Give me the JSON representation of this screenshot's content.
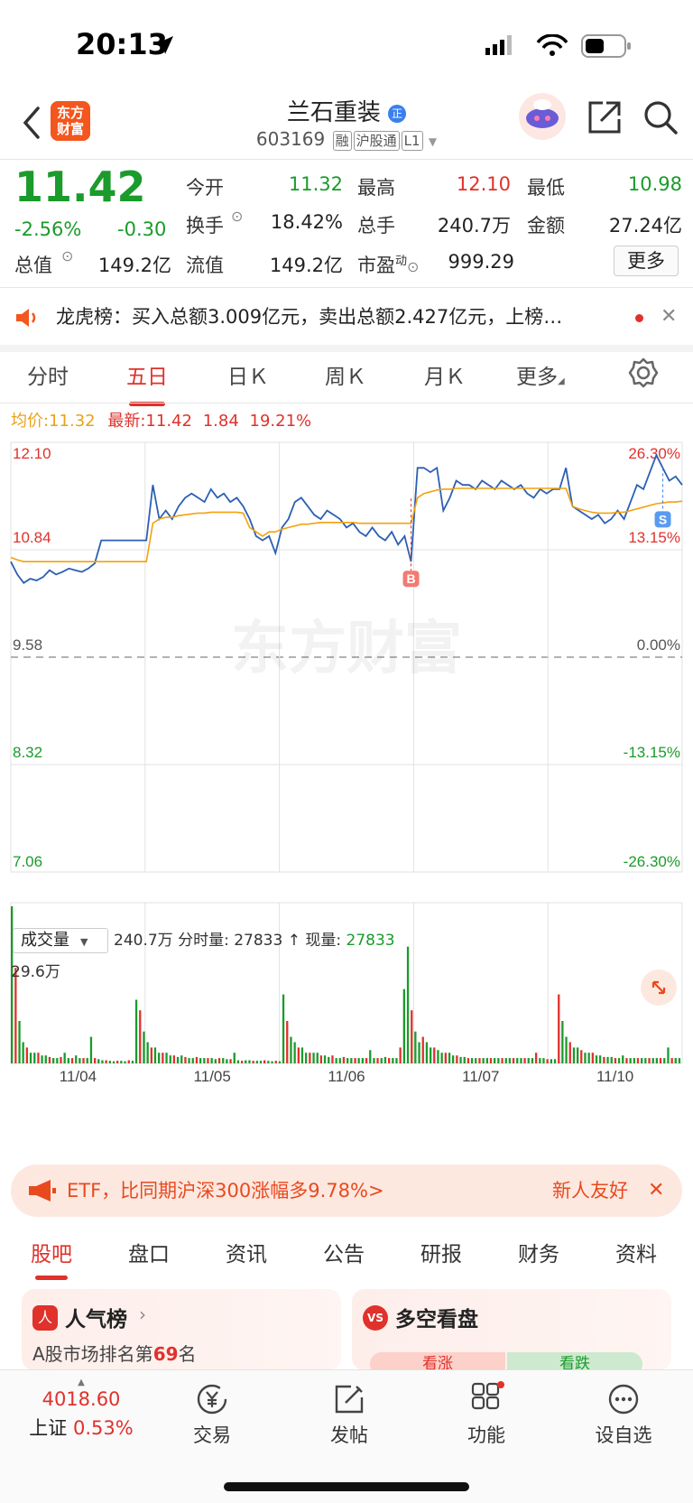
{
  "status": {
    "time": "20:13"
  },
  "header": {
    "logo_text": "东方财富",
    "title": "兰石重装",
    "title_badge": "正",
    "code": "603169",
    "tags": [
      "融",
      "沪股通",
      "L1"
    ]
  },
  "quote": {
    "price": "11.42",
    "change_pct": "-2.56%",
    "change": "-0.30",
    "rows": [
      [
        {
          "label": "今开",
          "value": "11.32",
          "color": "green"
        },
        {
          "label": "最高",
          "value": "12.10",
          "color": "red"
        },
        {
          "label": "最低",
          "value": "10.98",
          "color": "green"
        }
      ],
      [
        {
          "label": "换手",
          "value": "18.42%",
          "color": "dark"
        },
        {
          "label": "总手",
          "value": "240.7万",
          "color": "dark"
        },
        {
          "label": "金额",
          "value": "27.24亿",
          "color": "dark"
        }
      ],
      [
        {
          "label": "总值",
          "value": "149.2亿",
          "color": "dark"
        },
        {
          "label": "流值",
          "value": "149.2亿",
          "color": "dark"
        },
        {
          "label": "市盈",
          "value": "999.29",
          "color": "dark"
        }
      ]
    ],
    "pe_superscript": "动",
    "more_label": "更多"
  },
  "banner": {
    "text": "龙虎榜：买入总额3.009亿元，卖出总额2.427亿元，上榜…"
  },
  "tabs": {
    "items": [
      "分时",
      "五日",
      "日Ｋ",
      "周Ｋ",
      "月Ｋ",
      "更多"
    ],
    "active": 1
  },
  "chart_data": {
    "type": "line",
    "strip": {
      "avg_label": "均价:",
      "avg_value": "11.32",
      "latest_label": "最新:",
      "latest_value": "11.42",
      "change": "1.84",
      "change_pct": "19.21%"
    },
    "y_labels_left": [
      "12.10",
      "10.84",
      "9.58",
      "8.32",
      "7.06"
    ],
    "y_labels_right": [
      "26.30%",
      "13.15%",
      "0.00%",
      "-13.15%",
      "-26.30%"
    ],
    "ylim": [
      7.06,
      12.1
    ],
    "prev_close": 9.58,
    "x_labels": [
      "11/04",
      "11/05",
      "11/06",
      "11/07",
      "11/10"
    ],
    "series": [
      {
        "values": [
          10.7,
          10.55,
          10.45,
          10.5,
          10.48,
          10.52,
          10.6,
          10.55,
          10.58,
          10.62,
          10.6,
          10.58,
          10.62,
          10.68,
          10.95,
          10.95,
          10.95,
          10.95,
          10.95,
          10.95,
          10.95,
          10.95,
          11.6,
          11.2,
          11.3,
          11.2,
          11.35,
          11.45,
          11.5,
          11.45,
          11.4,
          11.55,
          11.45,
          11.5,
          11.4,
          11.45,
          11.35,
          11.2,
          11.0,
          10.95,
          11.0,
          10.8,
          11.1,
          11.2,
          11.4,
          11.45,
          11.35,
          11.25,
          11.2,
          11.3,
          11.25,
          11.2,
          11.1,
          11.15,
          11.05,
          11.0,
          11.1,
          11.0,
          10.95,
          11.05,
          10.9,
          11.0,
          10.7,
          11.8,
          11.8,
          11.75,
          11.8,
          11.3,
          11.45,
          11.65,
          11.6,
          11.6,
          11.55,
          11.65,
          11.6,
          11.55,
          11.65,
          11.6,
          11.55,
          11.6,
          11.5,
          11.45,
          11.55,
          11.5,
          11.55,
          11.55,
          11.8,
          11.35,
          11.3,
          11.25,
          11.2,
          11.25,
          11.15,
          11.2,
          11.3,
          11.2,
          11.4,
          11.6,
          11.55,
          11.75,
          11.95,
          11.8,
          11.65,
          11.7,
          11.6
        ]
      },
      {
        "values": [
          10.75,
          10.72,
          10.7,
          10.7,
          10.7,
          10.7,
          10.7,
          10.7,
          10.7,
          10.7,
          10.7,
          10.7,
          10.7,
          10.7,
          10.7,
          10.7,
          10.7,
          10.7,
          10.7,
          10.7,
          10.7,
          10.7,
          11.15,
          11.2,
          11.22,
          11.22,
          11.24,
          11.25,
          11.26,
          11.27,
          11.27,
          11.28,
          11.28,
          11.28,
          11.28,
          11.28,
          11.27,
          11.1,
          11.05,
          11.0,
          11.05,
          11.05,
          11.08,
          11.1,
          11.12,
          11.14,
          11.14,
          11.15,
          11.16,
          11.16,
          11.16,
          11.16,
          11.16,
          11.16,
          11.15,
          11.15,
          11.15,
          11.15,
          11.15,
          11.15,
          11.15,
          11.15,
          11.15,
          11.45,
          11.5,
          11.52,
          11.54,
          11.55,
          11.55,
          11.56,
          11.56,
          11.56,
          11.56,
          11.56,
          11.56,
          11.56,
          11.56,
          11.56,
          11.56,
          11.56,
          11.56,
          11.56,
          11.56,
          11.56,
          11.56,
          11.56,
          11.56,
          11.35,
          11.32,
          11.3,
          11.28,
          11.27,
          11.27,
          11.27,
          11.28,
          11.28,
          11.3,
          11.32,
          11.34,
          11.36,
          11.38,
          11.39,
          11.4,
          11.4,
          11.41
        ]
      }
    ],
    "markers": [
      {
        "label": "B"
      },
      {
        "label": "S"
      }
    ],
    "watermark": "东方财富"
  },
  "volume": {
    "selector": "成交量",
    "total": "240.7万",
    "tick_label": "分时量:",
    "tick_value": "27833",
    "now_label": "现量:",
    "now_value": "27833",
    "max_label": "29.6万",
    "values": [
      29.6,
      18,
      8,
      4,
      3,
      2,
      2,
      2,
      1.5,
      1.5,
      1.2,
      1,
      1,
      1.2,
      2,
      1,
      1,
      1.5,
      1,
      1,
      1,
      5,
      1,
      0.8,
      0.6,
      0.6,
      0.5,
      0.4,
      0.5,
      0.5,
      0.4,
      0.6,
      0.5,
      12,
      10,
      6,
      4,
      3,
      3,
      2,
      2,
      2,
      1.5,
      1.5,
      1.2,
      1.5,
      1.2,
      1,
      1,
      1.2,
      1,
      1,
      1,
      1,
      0.8,
      1,
      1,
      0.8,
      0.8,
      2,
      0.6,
      0.5,
      0.6,
      0.6,
      0.5,
      0.5,
      0.5,
      0.6,
      0.5,
      0.4,
      0.5,
      0.4,
      13,
      8,
      5,
      4,
      3,
      3,
      2,
      2,
      2,
      2,
      1.5,
      1.5,
      1.2,
      1.5,
      1,
      1,
      1.2,
      1,
      1,
      1,
      1,
      1,
      1,
      2.5,
      1,
      1,
      1,
      1.2,
      1,
      1,
      1,
      3,
      14,
      22,
      10,
      6,
      4,
      5,
      4,
      3,
      3,
      2.5,
      2,
      2,
      2,
      1.5,
      1.5,
      1.2,
      1.2,
      1,
      1,
      1,
      1,
      1,
      1,
      1,
      1,
      1,
      1,
      1,
      1,
      1,
      1,
      1,
      1,
      1,
      1,
      2,
      1,
      1,
      0.8,
      0.8,
      0.8,
      13,
      8,
      5,
      4,
      3,
      3,
      2.5,
      2,
      2,
      2,
      1.5,
      1.5,
      1.2,
      1.2,
      1.2,
      1,
      1,
      1.5,
      1,
      1,
      1,
      1,
      1,
      1,
      1,
      1,
      1,
      1,
      1,
      3,
      1,
      1,
      1
    ]
  },
  "promo": {
    "text": "ETF，比同期沪深300涨幅多9.78%>",
    "right": "新人友好"
  },
  "subtabs": {
    "items": [
      "股吧",
      "盘口",
      "资讯",
      "公告",
      "研报",
      "财务",
      "资料"
    ],
    "active": 0
  },
  "cards": [
    {
      "icon": "人",
      "title": "人气榜",
      "desc_prefix": "A股市场排名第",
      "rank": "69",
      "desc_suffix": "名"
    },
    {
      "icon": "VS",
      "title": "多空看盘",
      "up": "看涨",
      "down": "看跌"
    }
  ],
  "bottombar": {
    "index_value": "4018.60",
    "index_name": "上证",
    "index_change": "0.53%",
    "items": [
      "交易",
      "发帖",
      "功能",
      "设自选"
    ]
  }
}
